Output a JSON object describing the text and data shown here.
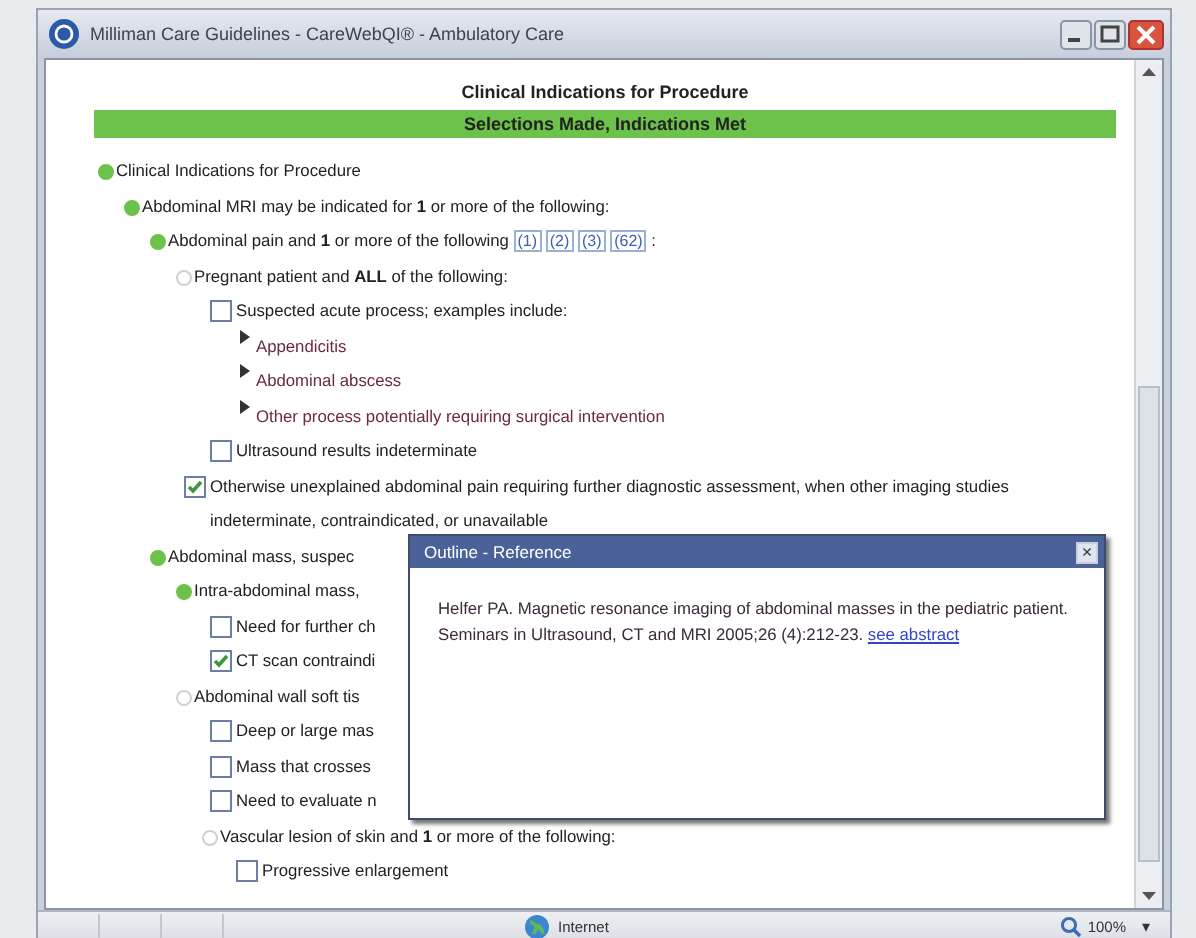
{
  "window": {
    "title": "Milliman Care Guidelines - CareWebQI® - Ambulatory Care"
  },
  "page": {
    "heading": "Clinical Indications for Procedure",
    "status_banner": "Selections Made, Indications Met"
  },
  "outline": [
    {
      "kind": "dot",
      "met": true,
      "text": "Clinical Indications for Procedure",
      "children": [
        {
          "kind": "dot",
          "met": true,
          "text": "Abdominal MRI may be indicated for **1** or more of the following:",
          "children": [
            {
              "kind": "dot",
              "met": true,
              "text": "Abdominal pain and **1** or more of the following ",
              "refs": [
                "(1)",
                "(2)",
                "(3)",
                "(62)"
              ],
              "suffix": " :",
              "children": [
                {
                  "kind": "dot",
                  "met": false,
                  "text": "Pregnant patient and **ALL** of the following:",
                  "children": [
                    {
                      "kind": "checkbox",
                      "checked": false,
                      "text": "Suspected acute process; examples include:",
                      "children": [
                        {
                          "kind": "bullet",
                          "text": "Appendicitis"
                        },
                        {
                          "kind": "bullet",
                          "text": "Abdominal abscess"
                        },
                        {
                          "kind": "bullet",
                          "text": "Other process potentially requiring surgical intervention"
                        }
                      ]
                    },
                    {
                      "kind": "checkbox",
                      "checked": false,
                      "text": "Ultrasound results indeterminate"
                    }
                  ]
                },
                {
                  "kind": "checkbox",
                  "checked": true,
                  "text": "Otherwise unexplained abdominal pain requiring further diagnostic assessment, when other imaging studies indeterminate, contraindicated, or unavailable"
                }
              ]
            },
            {
              "kind": "dot",
              "met": true,
              "text": "Abdominal mass, suspec",
              "children": [
                {
                  "kind": "dot",
                  "met": true,
                  "text": "Intra-abdominal mass,",
                  "children": [
                    {
                      "kind": "checkbox",
                      "checked": false,
                      "text": "Need for further ch"
                    },
                    {
                      "kind": "checkbox",
                      "checked": true,
                      "text": "CT scan contraindi"
                    }
                  ]
                },
                {
                  "kind": "dot",
                  "met": false,
                  "text": "Abdominal wall soft tis",
                  "children": [
                    {
                      "kind": "checkbox",
                      "checked": false,
                      "text": "Deep or large mas"
                    },
                    {
                      "kind": "checkbox",
                      "checked": false,
                      "text": "Mass that crosses"
                    },
                    {
                      "kind": "checkbox",
                      "checked": false,
                      "text": "Need to evaluate n"
                    },
                    {
                      "kind": "dot",
                      "met": false,
                      "text": "Vascular lesion of skin and **1** or more of the following:",
                      "children": [
                        {
                          "kind": "checkbox",
                          "checked": false,
                          "text": "Progressive enlargement"
                        }
                      ]
                    }
                  ]
                }
              ]
            }
          ]
        }
      ]
    }
  ],
  "popup": {
    "title": "Outline - Reference",
    "close": "×",
    "citation": "Helfer PA. Magnetic resonance imaging of abdominal masses in the pediatric patient. Seminars in Ultrasound, CT and MRI 2005;26 (4):212-23. ",
    "link": "see abstract"
  },
  "status_bar": {
    "zone": "Internet",
    "zoom": "100%",
    "zoom_menu": "▾"
  }
}
